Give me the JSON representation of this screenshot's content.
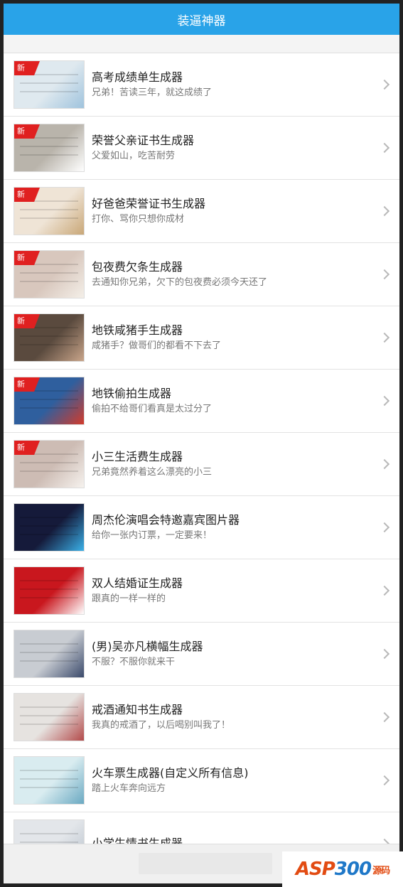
{
  "header": {
    "title": "装逼神器"
  },
  "items": [
    {
      "title": "高考成绩单生成器",
      "subtitle": "兄弟！苦读三年，就这成绩了",
      "badge": "新",
      "thumb_color": "#dfe9ef",
      "thumb_accent": "#9fc3dd"
    },
    {
      "title": "荣誉父亲证书生成器",
      "subtitle": "父爱如山，吃苦耐劳",
      "badge": "新",
      "thumb_color": "#b9b4ab",
      "thumb_accent": "#ffffff"
    },
    {
      "title": "好爸爸荣誉证书生成器",
      "subtitle": "打你、骂你只想你成材",
      "badge": "新",
      "thumb_color": "#efe4d6",
      "thumb_accent": "#c9a777"
    },
    {
      "title": "包夜费欠条生成器",
      "subtitle": "去通知你兄弟，欠下的包夜费必须今天还了",
      "badge": "新",
      "thumb_color": "#d8c7bd",
      "thumb_accent": "#f4efe8"
    },
    {
      "title": "地铁咸猪手生成器",
      "subtitle": "咸猪手？做哥们的都看不下去了",
      "badge": "新",
      "thumb_color": "#5a4a3e",
      "thumb_accent": "#c9a58a"
    },
    {
      "title": "地铁偷拍生成器",
      "subtitle": "偷拍不给哥们看真是太过分了",
      "badge": "新",
      "thumb_color": "#2f5f9e",
      "thumb_accent": "#d23b2b"
    },
    {
      "title": "小三生活费生成器",
      "subtitle": "兄弟竟然养着这么漂亮的小三",
      "badge": "新",
      "thumb_color": "#cdbcb4",
      "thumb_accent": "#f6f2ee"
    },
    {
      "title": "周杰伦演唱会特邀嘉宾图片器",
      "subtitle": "给你一张内订票，一定要来！",
      "badge": "",
      "thumb_color": "#151a3a",
      "thumb_accent": "#3ab0e8"
    },
    {
      "title": "双人结婚证生成器",
      "subtitle": "跟真的一样一样的",
      "badge": "",
      "thumb_color": "#c9171e",
      "thumb_accent": "#ffffff"
    },
    {
      "title": "(男)吴亦凡横幅生成器",
      "subtitle": "不服？不服你就来干",
      "badge": "",
      "thumb_color": "#c8ccd2",
      "thumb_accent": "#3b4a6b"
    },
    {
      "title": "戒酒通知书生成器",
      "subtitle": "我真的戒酒了，以后喝别叫我了！",
      "badge": "",
      "thumb_color": "#e6e3e0",
      "thumb_accent": "#b34a4a"
    },
    {
      "title": "火车票生成器(自定义所有信息)",
      "subtitle": "踏上火车奔向远方",
      "badge": "",
      "thumb_color": "#d9ecf0",
      "thumb_accent": "#6aa9c2"
    },
    {
      "title": "小学生情书生成器",
      "subtitle": "",
      "badge": "",
      "thumb_color": "#e3e6ea",
      "thumb_accent": "#b8c2cc"
    }
  ],
  "watermark": {
    "brand": "ASP",
    "brand_num": "300",
    "brand_suffix": "源码",
    "tld": ".com"
  }
}
